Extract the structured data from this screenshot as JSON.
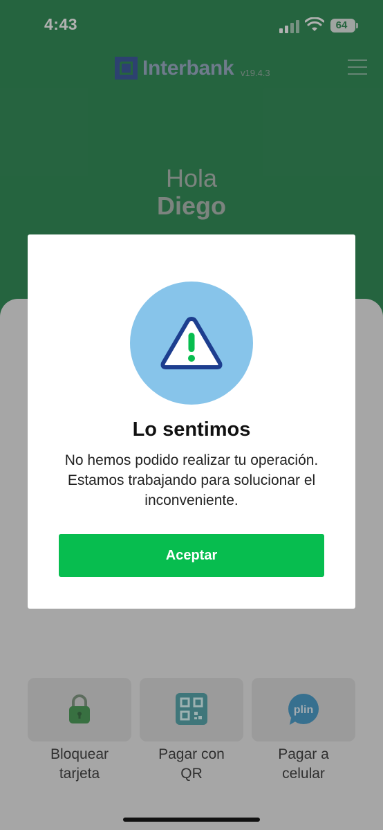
{
  "status_bar": {
    "time": "4:43",
    "battery": "64"
  },
  "header": {
    "brand": "Interbank",
    "version": "v19.4.3"
  },
  "greeting": {
    "hello": "Hola",
    "name": "Diego"
  },
  "quick_actions": [
    {
      "label_line1": "Bloquear",
      "label_line2": "tarjeta",
      "icon": "lock-icon"
    },
    {
      "label_line1": "Pagar con",
      "label_line2": "QR",
      "icon": "qr-code-icon"
    },
    {
      "label_line1": "Pagar a",
      "label_line2": "celular",
      "icon": "plin-icon",
      "icon_text": "plin"
    }
  ],
  "dialog": {
    "icon": "warning-icon",
    "title": "Lo sentimos",
    "message": "No hemos podido realizar tu operación. Estamos trabajando para solucionar el inconveniente.",
    "accept_label": "Aceptar"
  },
  "colors": {
    "brand_green": "#0f7a3b",
    "button_green": "#07bd4f",
    "alert_circle": "#87c4ea",
    "brand_navy": "#1d3e8f"
  }
}
